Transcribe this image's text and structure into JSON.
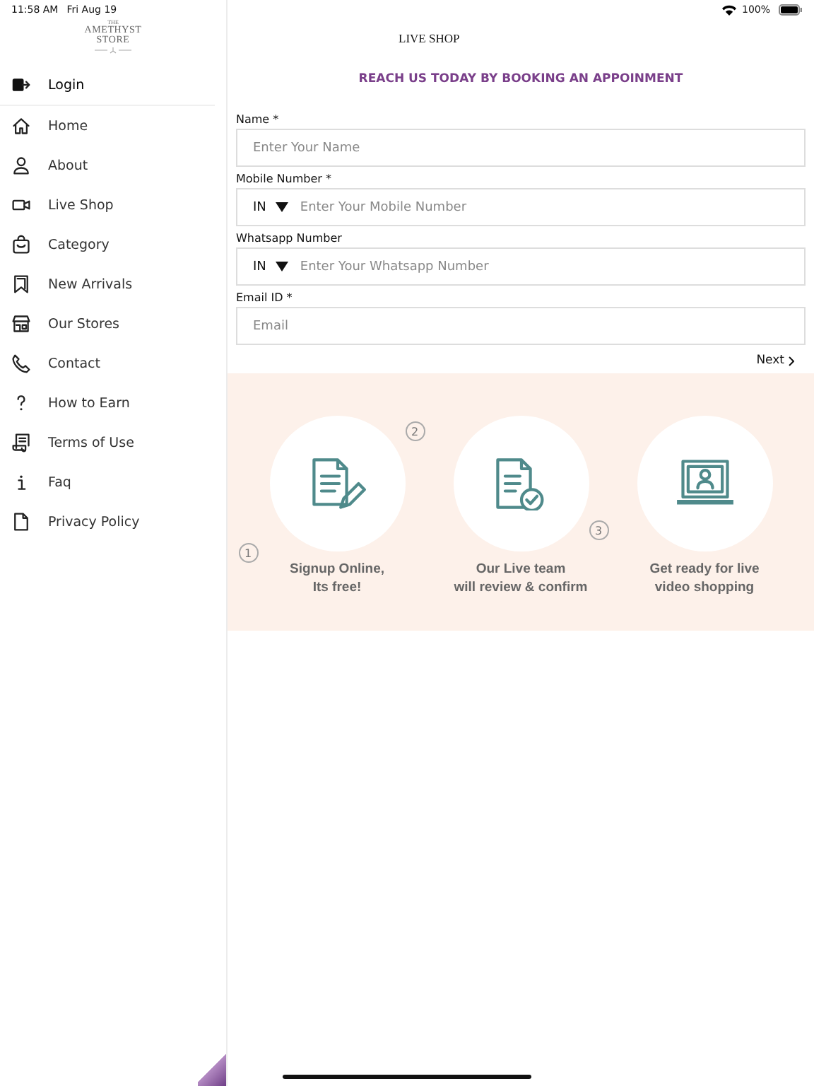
{
  "status_bar": {
    "time": "11:58 AM",
    "date": "Fri Aug 19",
    "battery": "100%"
  },
  "logo": {
    "small": "THE",
    "line_1": "AMETHYST",
    "line_2": "STORE"
  },
  "sidebar": {
    "items": [
      {
        "label": "Login"
      },
      {
        "label": "Home"
      },
      {
        "label": "About"
      },
      {
        "label": "Live Shop"
      },
      {
        "label": "Category"
      },
      {
        "label": "New Arrivals"
      },
      {
        "label": "Our Stores"
      },
      {
        "label": "Contact"
      },
      {
        "label": "How to Earn"
      },
      {
        "label": "Terms of Use"
      },
      {
        "label": "Faq"
      },
      {
        "label": "Privacy Policy"
      }
    ]
  },
  "page_title": "LIVE SHOP",
  "heading": "REACH US TODAY BY BOOKING AN APPOINMENT",
  "form": {
    "fields": [
      {
        "label": "Name *",
        "kind": "text",
        "placeholder": "Enter Your Name"
      },
      {
        "label": "Mobile Number *",
        "kind": "phone",
        "country": "IN",
        "placeholder": "Enter Your Mobile Number"
      },
      {
        "label": "Whatsapp Number",
        "kind": "phone",
        "country": "IN",
        "placeholder": "Enter Your Whatsapp Number"
      },
      {
        "label": "Email ID *",
        "kind": "text",
        "placeholder": "Email"
      }
    ],
    "next": "Next"
  },
  "steps": [
    {
      "number": "1",
      "caption": [
        "Signup Online,",
        "Its free!"
      ]
    },
    {
      "number": "2",
      "caption": [
        "Our Live team",
        "will review & confirm"
      ]
    },
    {
      "number": "3",
      "caption": [
        "Get ready for live",
        "video shopping"
      ]
    }
  ]
}
